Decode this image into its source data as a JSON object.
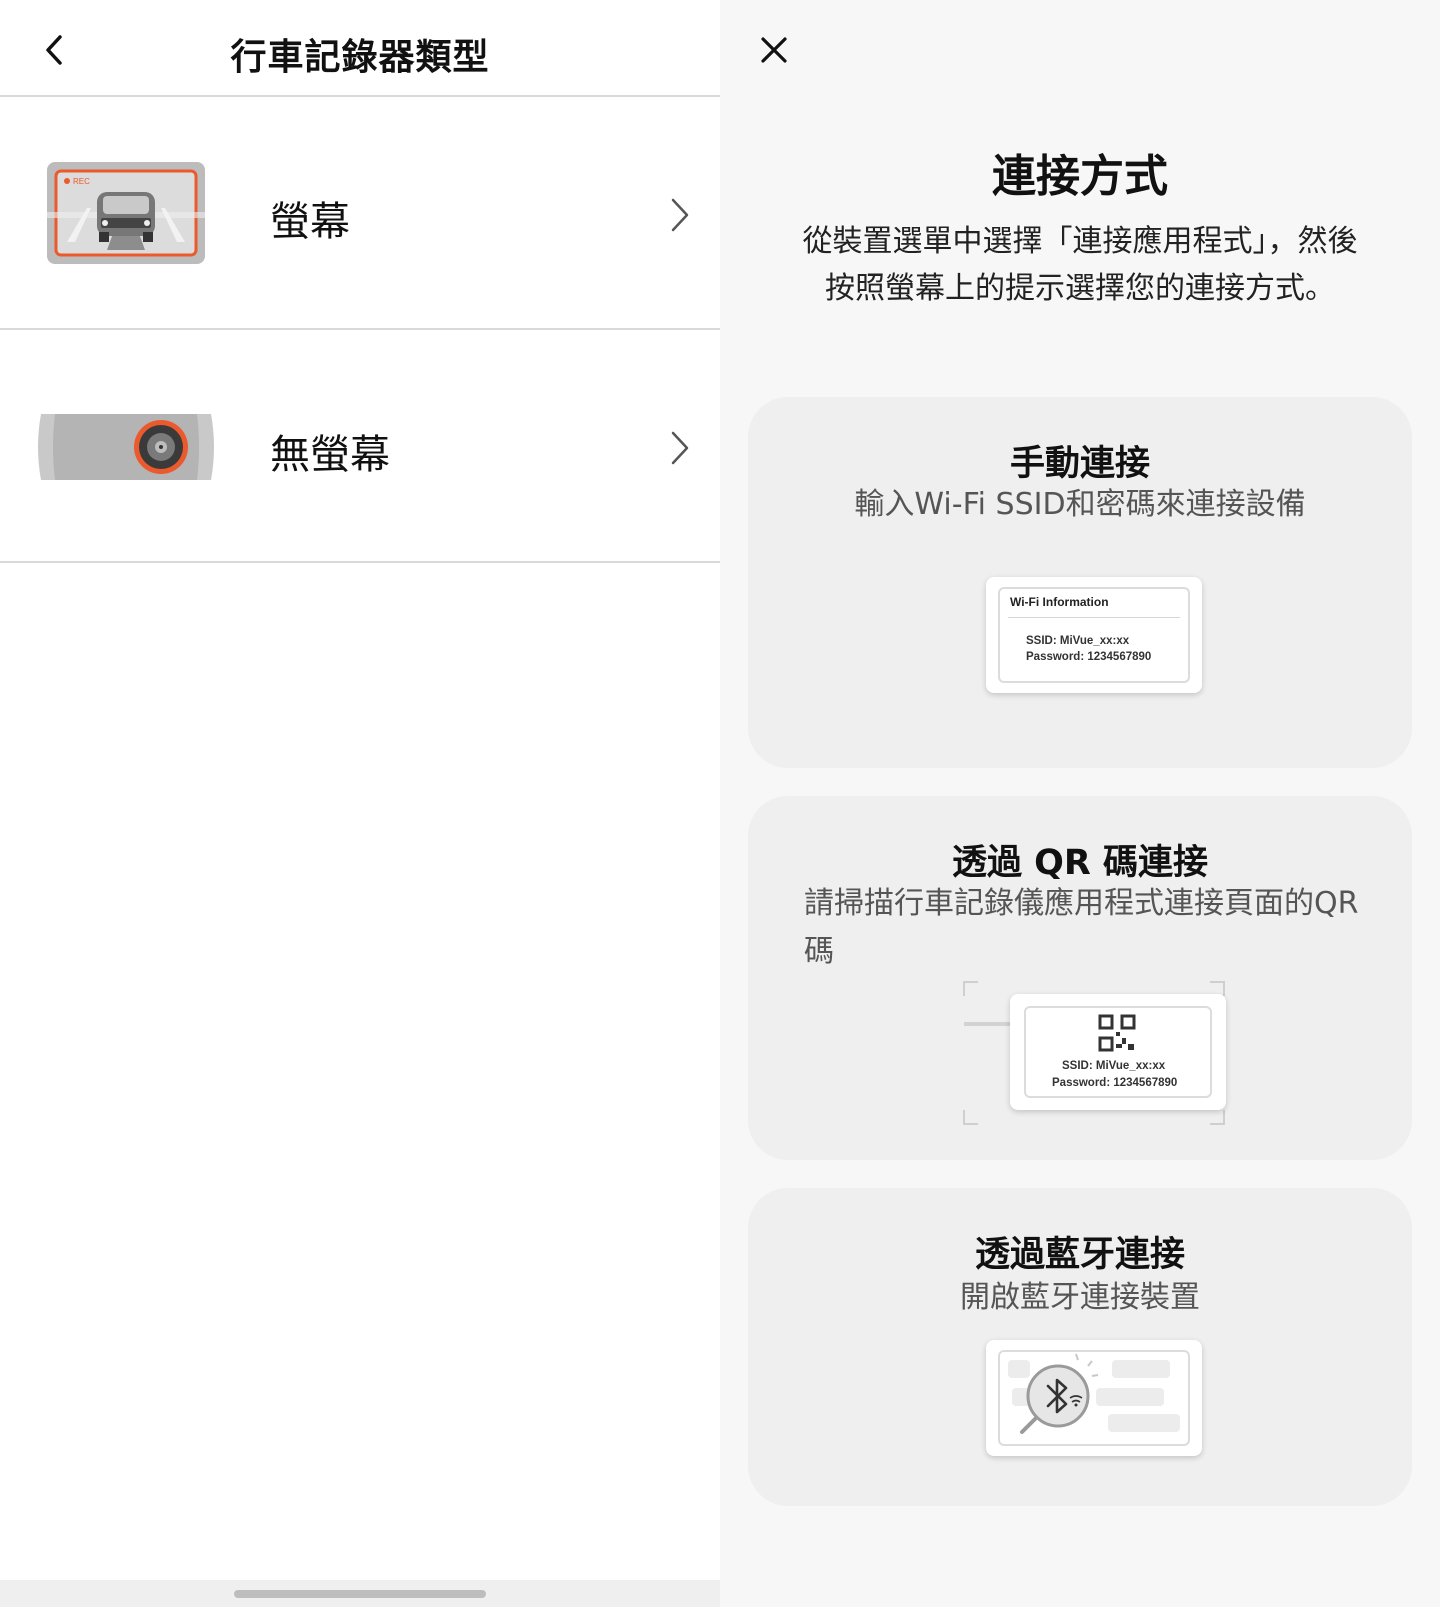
{
  "left_panel": {
    "title": "行車記錄器類型",
    "back_icon": "chevron-left-icon",
    "options": [
      {
        "label": "螢幕",
        "image": "screen-dashcam-image",
        "rec_label": "REC",
        "chevron": "chevron-right-icon"
      },
      {
        "label": "無螢幕",
        "image": "screenless-dashcam-image",
        "chevron": "chevron-right-icon"
      }
    ]
  },
  "right_panel": {
    "close_icon": "close-icon",
    "title": "連接方式",
    "description": "從裝置選單中選擇「連接應用程式」，然後按照螢幕上的提示選擇您的連接方式。",
    "methods": [
      {
        "title": "手動連接",
        "description": "輸入Wi-Fi SSID和密碼來連接設備",
        "illustration": {
          "heading": "Wi-Fi Information",
          "ssid": "SSID: MiVue_xx:xx",
          "password": "Password: 1234567890"
        }
      },
      {
        "title": "透過 QR 碼連接",
        "description": "請掃描行車記錄儀應用程式連接頁面的QR 碼",
        "illustration": {
          "ssid": "SSID: MiVue_xx:xx",
          "password": "Password: 1234567890"
        }
      },
      {
        "title": "透過藍牙連接",
        "description": "開啟藍牙連接裝置",
        "illustration": {
          "icon": "bluetooth-search-icon"
        }
      }
    ]
  },
  "colors": {
    "accent_orange": "#ea5a2c",
    "divider": "#d9d9d9",
    "card_bg": "#efefef",
    "right_bg": "#f7f7f7"
  }
}
